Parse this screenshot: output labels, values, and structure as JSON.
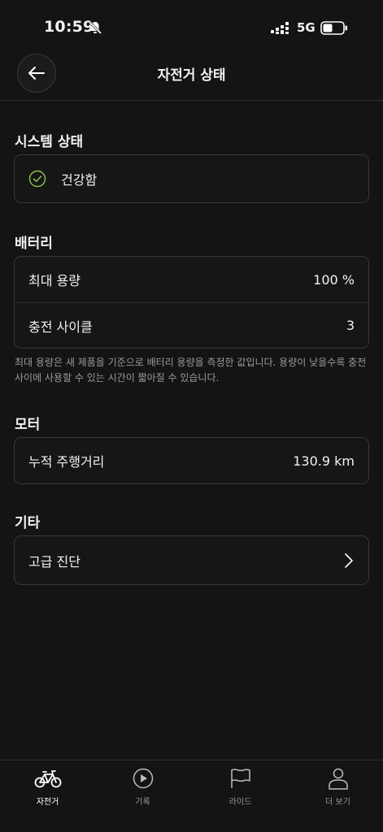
{
  "status": {
    "time": "10:59",
    "network": "5G"
  },
  "header": {
    "title": "자전거 상태"
  },
  "system": {
    "title": "시스템 상태",
    "state": "건강함"
  },
  "battery": {
    "title": "배터리",
    "rows": [
      {
        "label": "최대 용량",
        "value": "100 %"
      },
      {
        "label": "충전 사이클",
        "value": "3"
      }
    ],
    "note": "최대 용량은 새 제품을 기준으로 배터리 용량을 측정한 값입니다. 용량이 낮을수록 충전 사이에 사용할 수 있는 시간이 짧아질 수 있습니다."
  },
  "motor": {
    "title": "모터",
    "rows": [
      {
        "label": "누적 주행거리",
        "value": "130.9 km"
      }
    ]
  },
  "other": {
    "title": "기타",
    "rows": [
      {
        "label": "고급 진단"
      }
    ]
  },
  "tabs": [
    {
      "label": "자전거",
      "icon": "bike-icon",
      "active": true
    },
    {
      "label": "기록",
      "icon": "play-circle-icon",
      "active": false
    },
    {
      "label": "라이드",
      "icon": "flag-icon",
      "active": false
    },
    {
      "label": "더 보기",
      "icon": "person-icon",
      "active": false
    }
  ],
  "colors": {
    "background": "#141414",
    "check": "#8bc34a",
    "muted": "#9a9a9a"
  }
}
